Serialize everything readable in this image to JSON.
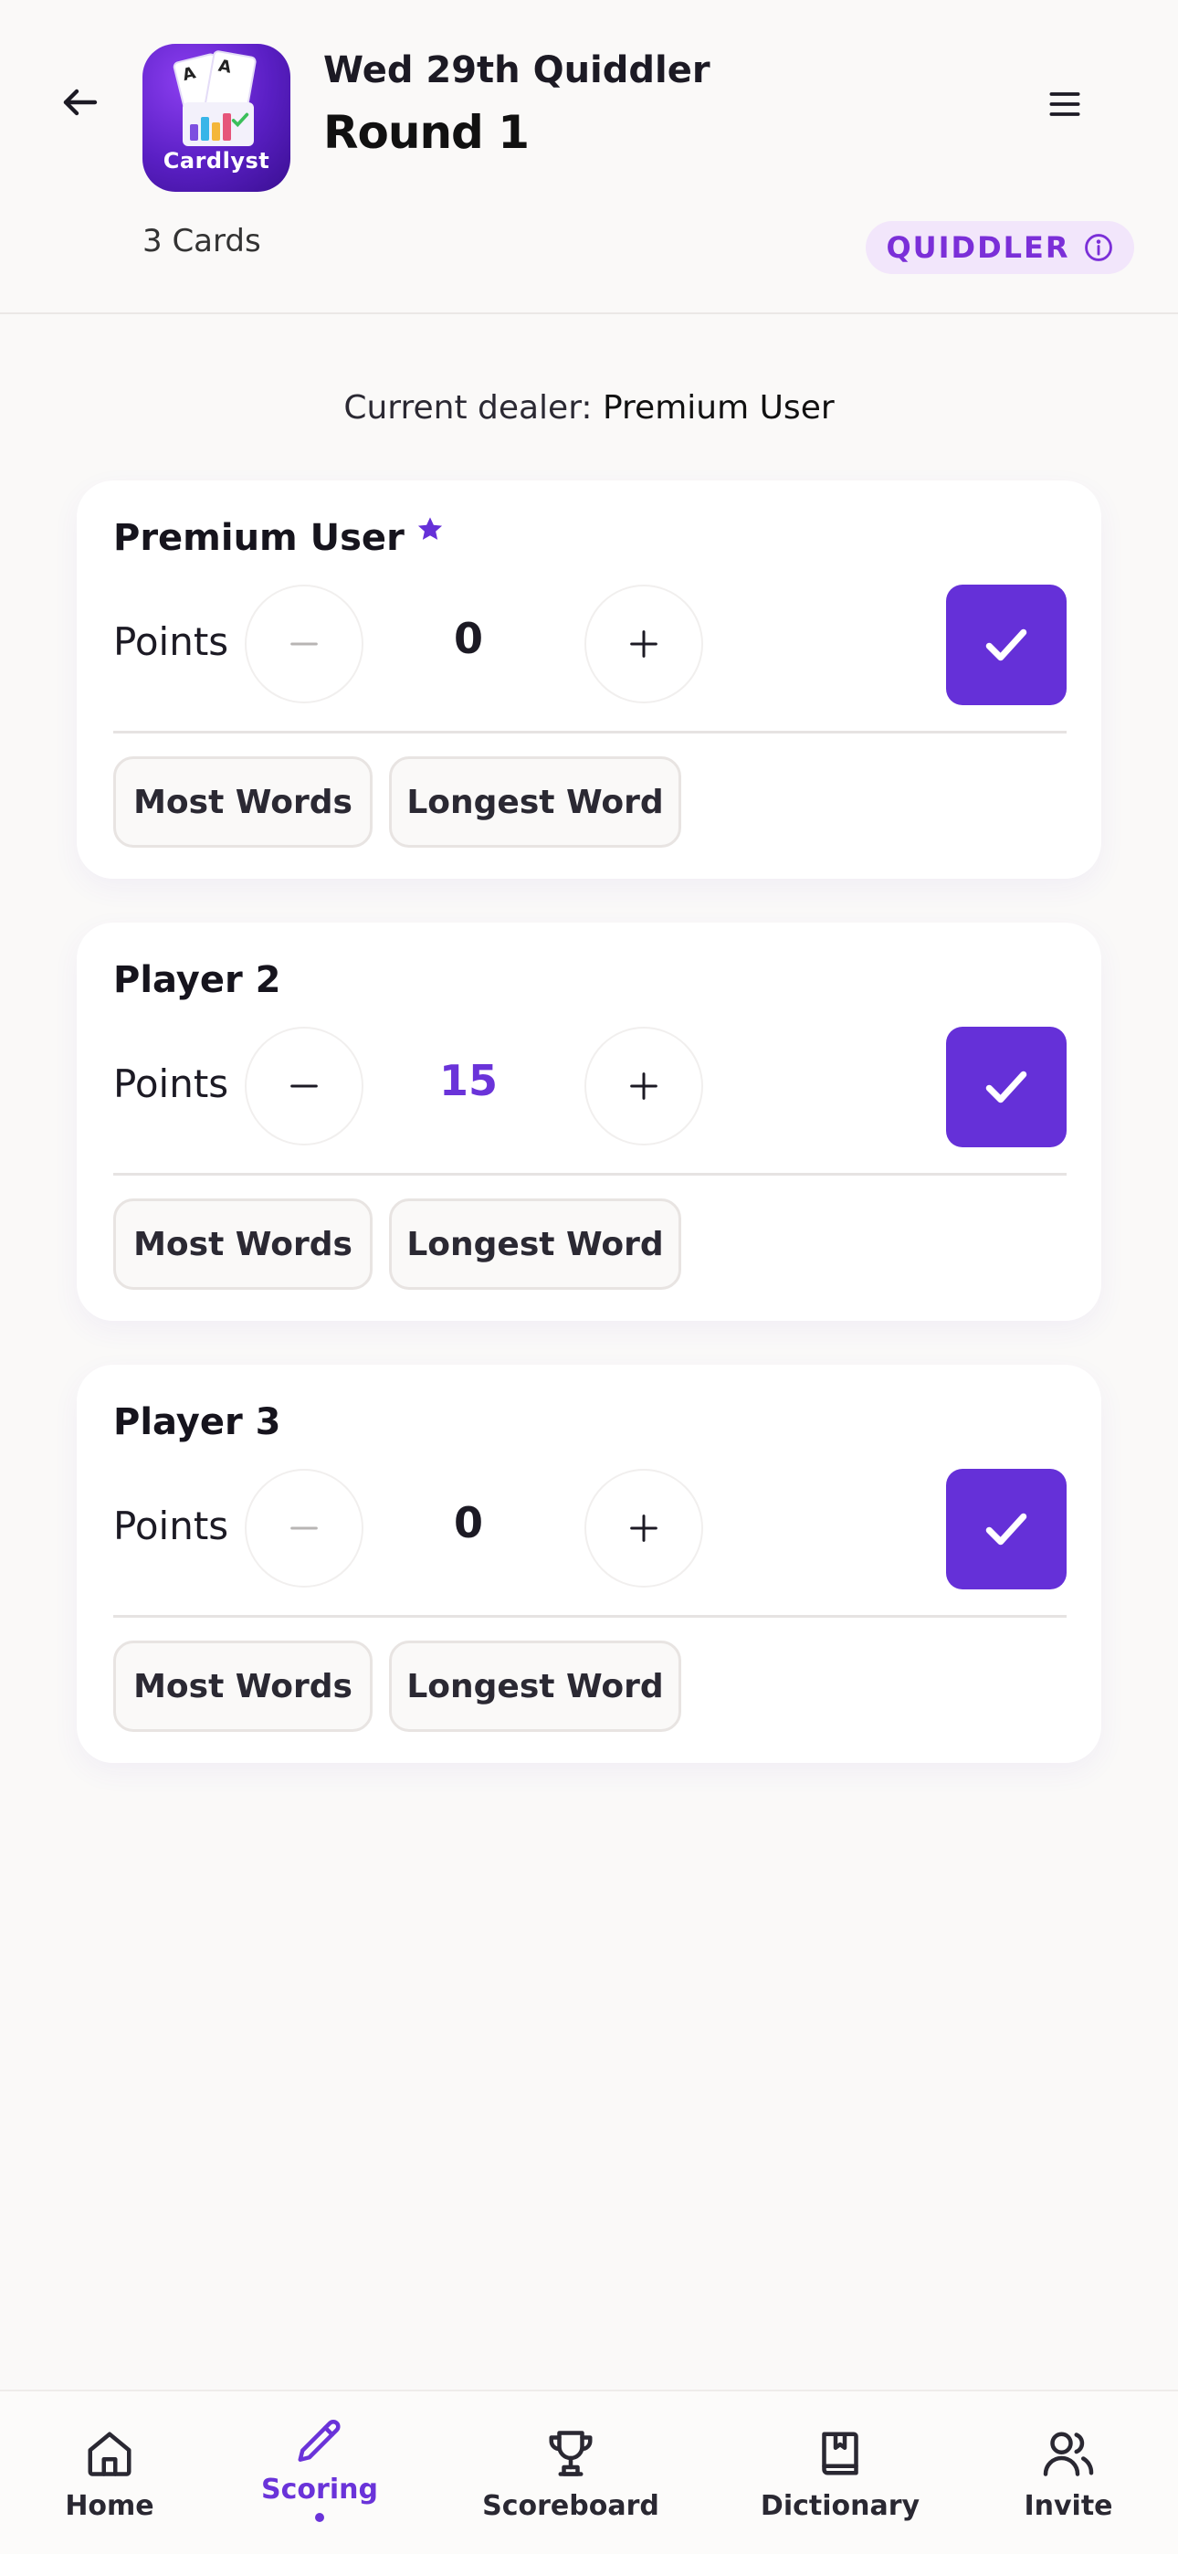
{
  "header": {
    "game_title": "Wed 29th Quiddler",
    "round_title": "Round 1",
    "cards_count": "3 Cards",
    "game_badge": "QUIDDLER",
    "app_icon_label": "Cardlyst",
    "icons": {
      "back": "arrow-left-icon",
      "menu": "hamburger-menu-icon",
      "info": "info-icon"
    }
  },
  "dealer": {
    "prefix": "Current dealer: ",
    "name": "Premium User"
  },
  "players": [
    {
      "name": "Premium User",
      "premium": true,
      "points_label": "Points",
      "points": "0",
      "minus_disabled": true,
      "bonus": [
        "Most Words",
        "Longest Word"
      ]
    },
    {
      "name": "Player 2",
      "premium": false,
      "points_label": "Points",
      "points": "15",
      "minus_disabled": false,
      "bonus": [
        "Most Words",
        "Longest Word"
      ]
    },
    {
      "name": "Player 3",
      "premium": false,
      "points_label": "Points",
      "points": "0",
      "minus_disabled": true,
      "bonus": [
        "Most Words",
        "Longest Word"
      ]
    }
  ],
  "nav": {
    "items": [
      {
        "label": "Home",
        "icon": "home-icon",
        "active": false
      },
      {
        "label": "Scoring",
        "icon": "pencil-icon",
        "active": true
      },
      {
        "label": "Scoreboard",
        "icon": "trophy-icon",
        "active": false
      },
      {
        "label": "Dictionary",
        "icon": "book-icon",
        "active": false
      },
      {
        "label": "Invite",
        "icon": "users-icon",
        "active": false
      }
    ]
  },
  "colors": {
    "accent": "#6530d8",
    "accent_text": "#6a33d9",
    "badge_bg": "#f2e6fb",
    "badge_text": "#7b2fd8",
    "background": "#faf9f8",
    "card": "#ffffff",
    "zero_points": "#1c1a24",
    "positive_points": "#6a33d9"
  }
}
